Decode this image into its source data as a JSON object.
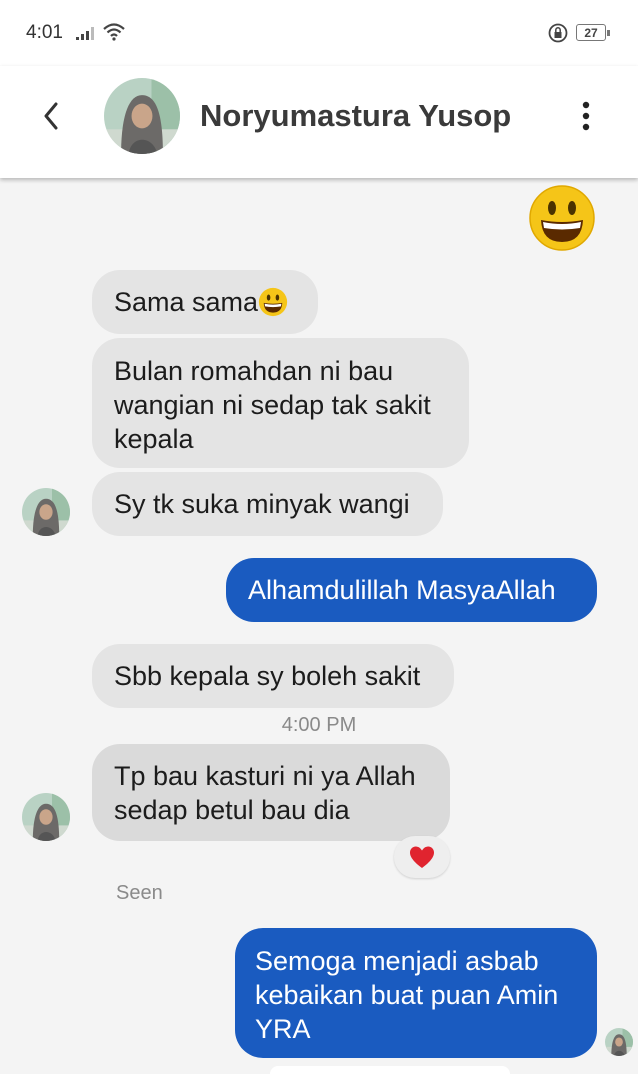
{
  "status_bar": {
    "time": "4:01",
    "battery": "27"
  },
  "header": {
    "name": "Noryumastura Yusop"
  },
  "messages": [
    {
      "text": "Sama sama"
    },
    {
      "text": "Bulan romahdan ni bau wangian ni sedap tak sakit kepala"
    },
    {
      "text": "Sy tk suka minyak wangi"
    },
    {
      "text": "Alhamdulillah MasyaAllah"
    },
    {
      "text": "Sbb kepala sy boleh sakit"
    },
    {
      "text": "Tp bau kasturi ni ya Allah sedap betul bau dia"
    },
    {
      "text": "Semoga menjadi asbab kebaikan buat puan Amin YRA"
    }
  ],
  "timestamp": "4:00 PM",
  "seen_label": "Seen",
  "colors": {
    "outgoing": "#1a5bc0",
    "incoming": "#e4e4e4",
    "reaction": "#e0242f"
  },
  "icons": [
    "back-arrow-icon",
    "more-vert-icon",
    "signal-icon",
    "wifi-icon",
    "lock-icon",
    "battery-icon",
    "grinning-emoji-icon",
    "heart-icon"
  ]
}
